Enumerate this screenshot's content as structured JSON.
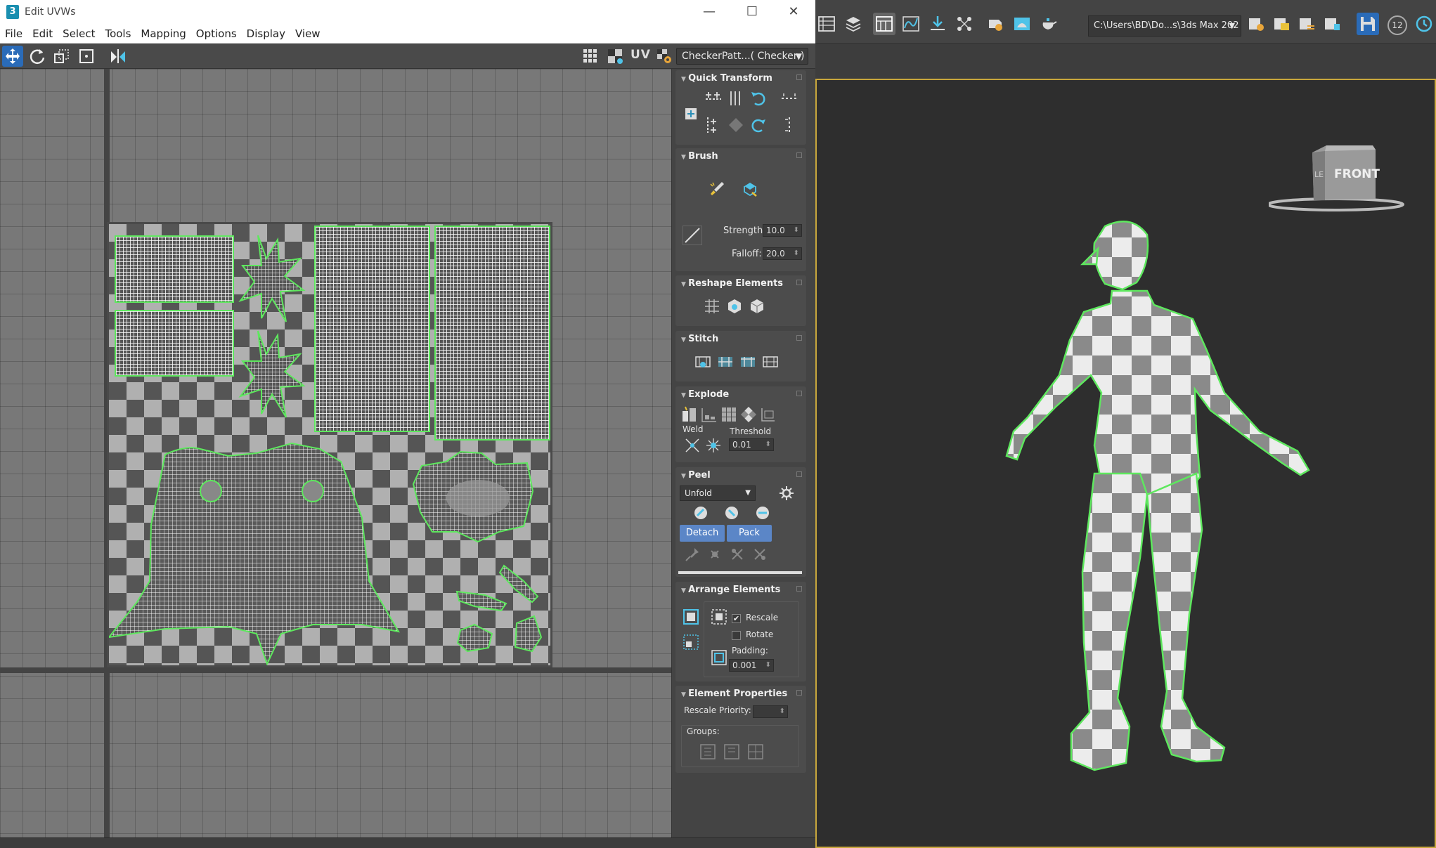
{
  "window": {
    "title": "Edit UVWs",
    "icon_letter": "3",
    "min": "—",
    "max": "☐",
    "close": "✕"
  },
  "menu": [
    "File",
    "Edit",
    "Select",
    "Tools",
    "Mapping",
    "Options",
    "Display",
    "View"
  ],
  "uv_toolbar": {
    "uv_label": "UV",
    "texture_dropdown": "CheckerPatt...( Checker )"
  },
  "rollouts": {
    "quick_transform": {
      "title": "Quick Transform"
    },
    "brush": {
      "title": "Brush",
      "strength_label": "Strength:",
      "strength_value": "10.0",
      "falloff_label": "Falloff:",
      "falloff_value": "20.0"
    },
    "reshape": {
      "title": "Reshape Elements"
    },
    "stitch": {
      "title": "Stitch"
    },
    "explode": {
      "title": "Explode",
      "weld_label": "Weld",
      "threshold_label": "Threshold",
      "threshold_value": "0.01"
    },
    "peel": {
      "title": "Peel",
      "mode": "Unfold",
      "detach": "Detach",
      "pack": "Pack"
    },
    "arrange": {
      "title": "Arrange Elements",
      "rescale": "Rescale",
      "rescale_checked": "✔",
      "rotate": "Rotate",
      "padding_label": "Padding:",
      "padding_value": "0.001"
    },
    "element_props": {
      "title": "Element Properties",
      "rescale_priority": "Rescale Priority:",
      "groups": "Groups:"
    }
  },
  "max_toolbar": {
    "path": "C:\\Users\\BD\\Do...s\\3ds Max 202",
    "counter": "12"
  },
  "viewport": {
    "viewcube_label": "FRONT",
    "viewcube_side": "LE"
  },
  "colors": {
    "seam": "#5ee85e",
    "accent": "#2a6bb8",
    "viewport_border": "#c8a73c"
  }
}
